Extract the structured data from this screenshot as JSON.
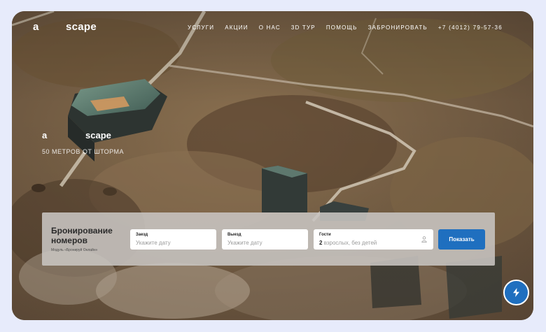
{
  "header": {
    "logo_left": "a",
    "logo_right": "scape",
    "nav": [
      "УСЛУГИ",
      "АКЦИИ",
      "О НАС",
      "3D ТУР",
      "ПОМОЩЬ",
      "ЗАБРОНИРОВАТЬ"
    ],
    "phone": "+7 (4012) 79-57-36"
  },
  "hero": {
    "logo_left": "a",
    "logo_right": "scape",
    "tagline": "50 МЕТРОВ ОТ ШТОРМА"
  },
  "booking": {
    "title": "Бронирование номеров",
    "subtitle": "Модуль «Бронируй Онлайн»",
    "checkin_label": "Заезд",
    "checkin_placeholder": "Укажите дату",
    "checkout_label": "Выезд",
    "checkout_placeholder": "Укажите дату",
    "guests_label": "Гости",
    "guests_count": "2",
    "guests_text": "взрослых, без детей",
    "submit_label": "Показать"
  },
  "icons": {
    "guests": "person-icon",
    "fab": "lightning-icon"
  },
  "colors": {
    "accent": "#1f6fbf",
    "page_background": "#e7ebfb"
  }
}
